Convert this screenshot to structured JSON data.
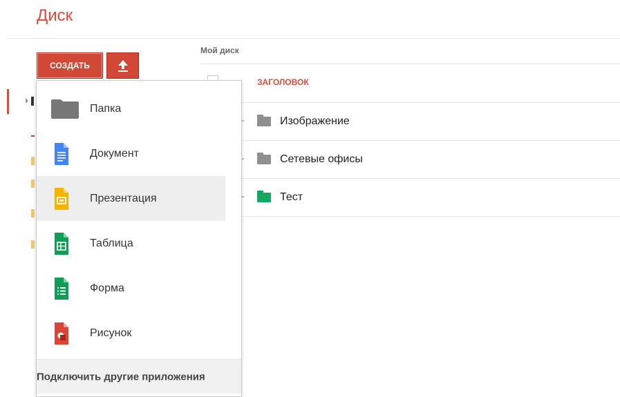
{
  "app": {
    "title": "Диск"
  },
  "toolbar": {
    "create_label": "СОЗДАТЬ",
    "upload_icon": "upload-arrow-icon"
  },
  "breadcrumb": "Мой диск",
  "file_list": {
    "column_header": "ЗАГОЛОВОК",
    "items": [
      {
        "name": "Изображение",
        "color": "#8f8f8f",
        "icon": "folder-icon"
      },
      {
        "name": "Сетевые офисы",
        "color": "#8f8f8f",
        "icon": "folder-icon"
      },
      {
        "name": "Тест",
        "color": "#16a765",
        "icon": "folder-icon"
      }
    ]
  },
  "create_menu": {
    "items": [
      {
        "label": "Папка",
        "icon": "folder-icon",
        "color": "#777777"
      },
      {
        "label": "Документ",
        "icon": "docs-icon",
        "color": "#4285f4"
      },
      {
        "label": "Презентация",
        "icon": "slides-icon",
        "color": "#f4b400",
        "highlighted": true
      },
      {
        "label": "Таблица",
        "icon": "sheets-icon",
        "color": "#0f9d58"
      },
      {
        "label": "Форма",
        "icon": "forms-icon",
        "color": "#0f9d58"
      },
      {
        "label": "Рисунок",
        "icon": "drawing-icon",
        "color": "#db4437"
      }
    ],
    "footer": "Подключить другие приложения"
  },
  "colors": {
    "accent": "#dd4b39",
    "button": "#d14836"
  }
}
